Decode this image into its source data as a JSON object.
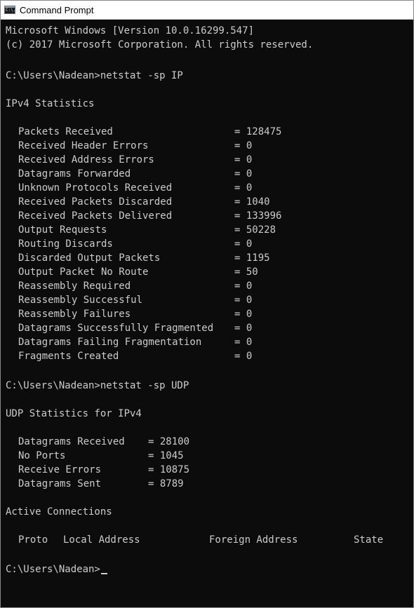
{
  "window": {
    "title": "Command Prompt",
    "icon": "cmd-icon",
    "icon_text": "C:\\."
  },
  "console": {
    "header_line1": "Microsoft Windows [Version 10.0.16299.547]",
    "header_line2": "(c) 2017 Microsoft Corporation. All rights reserved.",
    "cmd1": "C:\\Users\\Nadean>netstat -sp IP",
    "ipv4_heading": "IPv4 Statistics",
    "ipv4_stats": [
      {
        "label": "Packets Received",
        "value": "= 128475"
      },
      {
        "label": "Received Header Errors",
        "value": "= 0"
      },
      {
        "label": "Received Address Errors",
        "value": "= 0"
      },
      {
        "label": "Datagrams Forwarded",
        "value": "= 0"
      },
      {
        "label": "Unknown Protocols Received",
        "value": "= 0"
      },
      {
        "label": "Received Packets Discarded",
        "value": "= 1040"
      },
      {
        "label": "Received Packets Delivered",
        "value": "= 133996"
      },
      {
        "label": "Output Requests",
        "value": "= 50228"
      },
      {
        "label": "Routing Discards",
        "value": "= 0"
      },
      {
        "label": "Discarded Output Packets",
        "value": "= 1195"
      },
      {
        "label": "Output Packet No Route",
        "value": "= 50"
      },
      {
        "label": "Reassembly Required",
        "value": "= 0"
      },
      {
        "label": "Reassembly Successful",
        "value": "= 0"
      },
      {
        "label": "Reassembly Failures",
        "value": "= 0"
      },
      {
        "label": "Datagrams Successfully Fragmented",
        "value": "= 0"
      },
      {
        "label": "Datagrams Failing Fragmentation",
        "value": "= 0"
      },
      {
        "label": "Fragments Created",
        "value": "= 0"
      }
    ],
    "cmd2": "C:\\Users\\Nadean>netstat -sp UDP",
    "udp_heading": "UDP Statistics for IPv4",
    "udp_stats": [
      {
        "label": "Datagrams Received",
        "value": "= 28100"
      },
      {
        "label": "No Ports",
        "value": "= 1045"
      },
      {
        "label": "Receive Errors",
        "value": "= 10875"
      },
      {
        "label": "Datagrams Sent",
        "value": "= 8789"
      }
    ],
    "active_heading": "Active Connections",
    "columns": {
      "proto": "Proto",
      "local": "Local Address",
      "foreign": "Foreign Address",
      "state": "State"
    },
    "prompt": "C:\\Users\\Nadean>"
  },
  "colors": {
    "background": "#0c0c0c",
    "text": "#cccccc",
    "titlebar": "#ffffff"
  }
}
